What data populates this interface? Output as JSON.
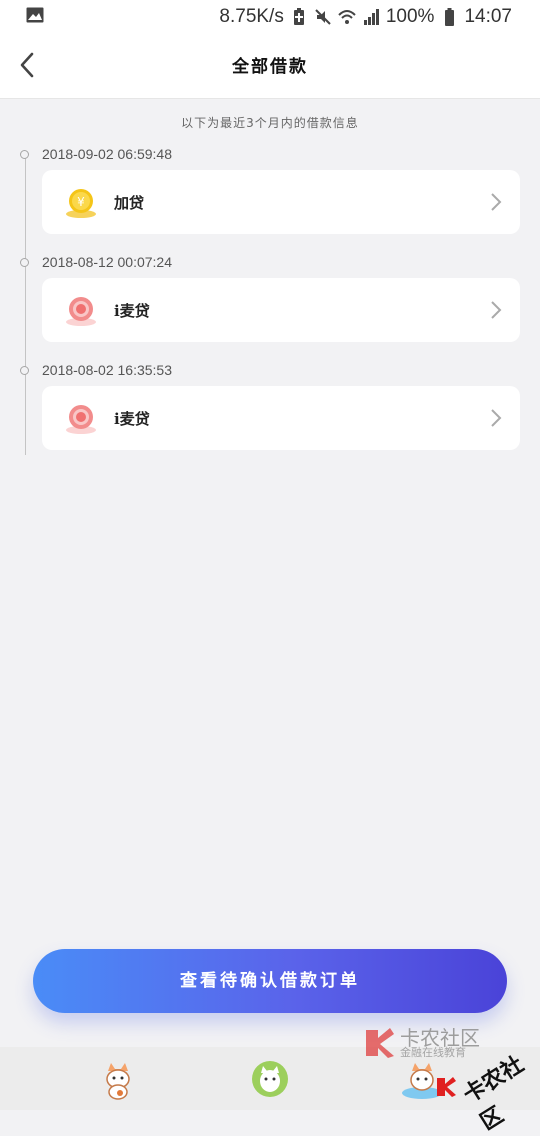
{
  "status_bar": {
    "speed": "8.75K/s",
    "battery": "100%",
    "time": "14:07",
    "icons": [
      "gallery-icon",
      "battery-saver-icon",
      "mute-icon",
      "wifi-icon",
      "4g-signal-icon",
      "battery-icon"
    ]
  },
  "header": {
    "title": "全部借款"
  },
  "hint": "以下为最近3个月内的借款信息",
  "loans": [
    {
      "date": "2018-09-02 06:59:48",
      "name": "加贷",
      "icon": "gold-coin-icon"
    },
    {
      "date": "2018-08-12 00:07:24",
      "name": "i麦贷",
      "icon": "red-coin-icon"
    },
    {
      "date": "2018-08-02 16:35:53",
      "name": "i麦贷",
      "icon": "red-coin-icon"
    }
  ],
  "cta_label": "查看待确认借款订单",
  "colors": {
    "cta_start": "#4a8cf7",
    "cta_end": "#4a43d8",
    "background": "#f2f2f4"
  },
  "watermark": {
    "title": "卡农社区",
    "subtitle": "金融在线教育",
    "stamp": "卡农社区"
  }
}
